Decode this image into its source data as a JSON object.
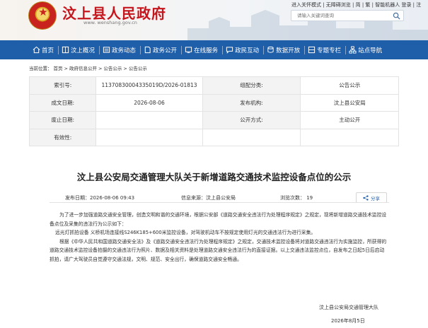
{
  "header": {
    "site_title": "汶上县人民政府",
    "site_url": "www. wenshang.gov.cn",
    "top_links": "进入关怀模式 | 无障碍浏览 | 简 | 繁 | 智能机器人  登录 | 注",
    "search_placeholder": "请输入关键词查询"
  },
  "nav": {
    "items": [
      "首页",
      "汶上概况",
      "政务动态",
      "政务公开",
      "在线服务",
      "政民互动",
      "数据开放",
      "专题专栏",
      "站点导航"
    ]
  },
  "breadcrumb": {
    "label": "当前位置：",
    "items": [
      "首页",
      "政府信息公开",
      "公告公示",
      "公告公示"
    ],
    "separator": ">"
  },
  "info": {
    "index_label": "索引号:",
    "index_value": "11370830004335019D/2026-01813",
    "category_label": "组配分类:",
    "category_value": "公告公示",
    "date_label": "成文日期:",
    "date_value": "2026-08-06",
    "issuer_label": "发布机构:",
    "issuer_value": "汶上县公安局",
    "abolish_label": "废止日期:",
    "abolish_value": "",
    "public_label": "公开方式:",
    "public_value": "主动公开",
    "validity_label": "有效性:",
    "validity_value": ""
  },
  "article": {
    "title": "汶上县公安局交通管理大队关于新增道路交通技术监控设备点位的公示",
    "publish_time": "发布日期：2026-08-06 09:43",
    "source": "信息来源：汶上县公安局",
    "views": "浏览次数： 19",
    "share_label": "分享",
    "paragraphs": [
      "为了进一步加强道路交通安全管理，创造文明和谐的交通环境，根据公安部《道路交通安全违法行为处理程序规定》之规定，现将新增道路交通技术监控设备点位及采集的违法行为公示如下：",
      "远光灯抓拍设备  义桥机场连接线S246K185+600米监控设备，对驾驶机动车不按规定使用灯光的交通违法行为进行采集。",
      "根据《中华人民共和国道路交通安全法》及《道路交通安全违法行为处理程序规定》之规定，交通技术监控设备将对道路交通违法行为实施监控，所获得的道路交通技术监控设备拍摄的交通违法行为照片、数据及相关资料是处理道路交通安全违法行为的直接证据。以上交通违法监控点位，自发布之日起5日后启动抓拍，请广大驾驶员自觉遵守交通法规，文明、规范、安全出行，确保道路交通安全畅通。"
    ],
    "signature": "汶上县公安局交通管理大队",
    "signature_date": "2026年8月5日"
  },
  "colors": {
    "brand_red": "#c4161c",
    "nav_blue": "#1f5ea8"
  },
  "icons": [
    "emblem",
    "search-icon",
    "home-icon",
    "book-icon",
    "news-icon",
    "doc-icon",
    "service-icon",
    "chat-icon",
    "data-icon",
    "topic-icon",
    "sitemap-icon",
    "share-icon"
  ]
}
